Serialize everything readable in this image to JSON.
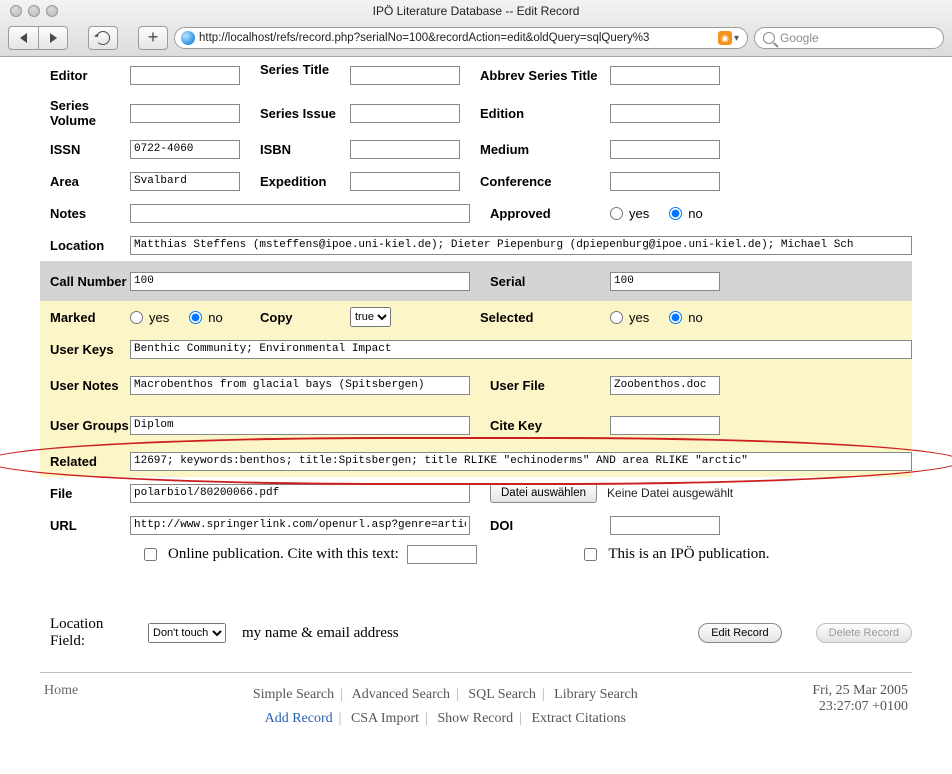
{
  "window": {
    "title": "IPÖ Literature Database -- Edit Record"
  },
  "browser": {
    "url": "http://localhost/refs/record.php?serialNo=100&recordAction=edit&oldQuery=sqlQuery%3",
    "search_placeholder": "Google"
  },
  "form": {
    "editor_label": "Editor",
    "editor": "",
    "series_title_label": "Series Title",
    "series_title": "",
    "abbrev_series_title_label": "Abbrev Series Title",
    "abbrev_series_title": "",
    "series_volume_label": "Series Volume",
    "series_volume": "",
    "series_issue_label": "Series Issue",
    "series_issue": "",
    "edition_label": "Edition",
    "edition": "",
    "issn_label": "ISSN",
    "issn": "0722-4060",
    "isbn_label": "ISBN",
    "isbn": "",
    "medium_label": "Medium",
    "medium": "",
    "area_label": "Area",
    "area": "Svalbard",
    "expedition_label": "Expedition",
    "expedition": "",
    "conference_label": "Conference",
    "conference": "",
    "notes_label": "Notes",
    "notes": "",
    "approved_label": "Approved",
    "location_label": "Location",
    "location": "Matthias Steffens (msteffens@ipoe.uni-kiel.de); Dieter Piepenburg (dpiepenburg@ipoe.uni-kiel.de); Michael Sch",
    "call_number_label": "Call Number",
    "call_number": "100",
    "serial_label": "Serial",
    "serial": "100",
    "marked_label": "Marked",
    "copy_label": "Copy",
    "copy_value": "true",
    "selected_label": "Selected",
    "user_keys_label": "User Keys",
    "user_keys": "Benthic Community; Environmental Impact",
    "user_notes_label": "User Notes",
    "user_notes": "Macrobenthos from glacial bays (Spitsbergen)",
    "user_file_label": "User File",
    "user_file": "Zoobenthos.doc",
    "user_groups_label": "User Groups",
    "user_groups": "Diplom",
    "cite_key_label": "Cite Key",
    "cite_key": "",
    "related_label": "Related",
    "related": "12697; keywords:benthos; title:Spitsbergen; title RLIKE \"echinoderms\" AND area RLIKE \"arctic\"",
    "file_label": "File",
    "file": "polarbiol/80200066.pdf",
    "file_button": "Datei auswählen",
    "file_status": "Keine Datei ausgewählt",
    "url_label": "URL",
    "url": "http://www.springerlink.com/openurl.asp?genre=article&issn=",
    "doi_label": "DOI",
    "doi": "",
    "online_pub_text": "Online publication. Cite with this text:",
    "ipo_pub_text": "This is an IPÖ publication.",
    "yes": "yes",
    "no": "no",
    "location_field_label": "Location Field:",
    "location_field_option": "Don't touch",
    "location_field_text": "my name & email address",
    "edit_btn": "Edit Record",
    "delete_btn": "Delete Record"
  },
  "footer": {
    "home": "Home",
    "simple": "Simple Search",
    "advanced": "Advanced Search",
    "sql": "SQL Search",
    "library": "Library Search",
    "add": "Add Record",
    "csa": "CSA Import",
    "show": "Show Record",
    "extract": "Extract Citations",
    "date": "Fri, 25 Mar 2005",
    "time": "23:27:07 +0100"
  }
}
